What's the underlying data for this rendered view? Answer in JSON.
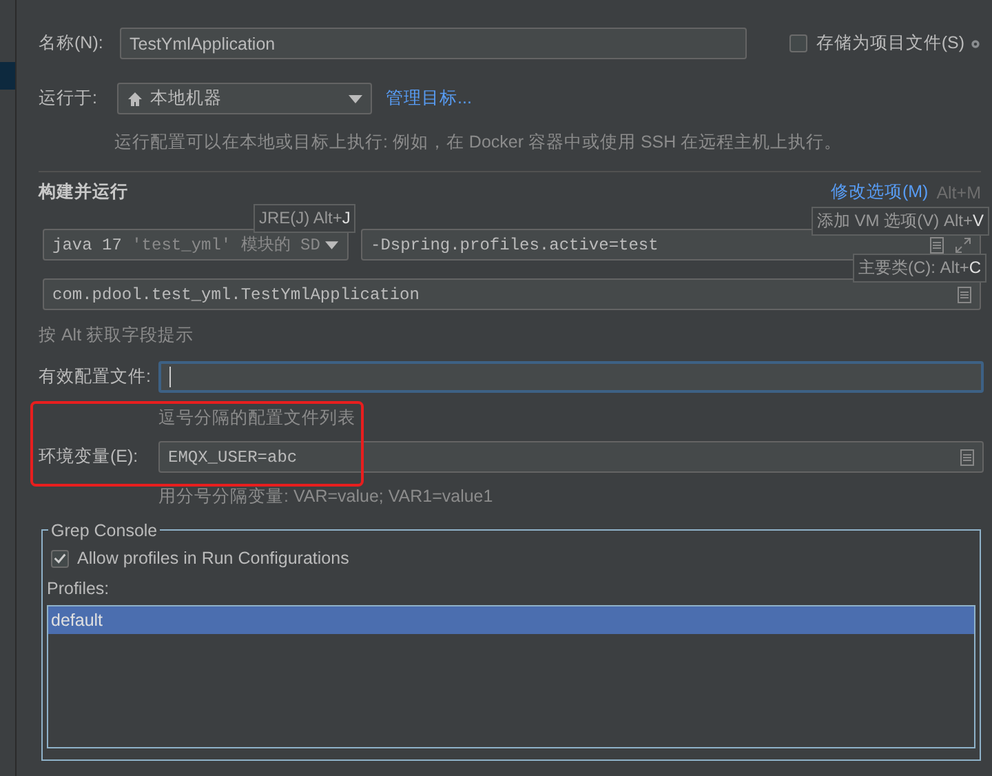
{
  "name": {
    "label": "名称(N):",
    "value": "TestYmlApplication"
  },
  "store_as_project_file": {
    "label": "存储为项目文件(S)",
    "checked": false
  },
  "run_on": {
    "label": "运行于:",
    "value": "本地机器",
    "link": "管理目标...",
    "hint": "运行配置可以在本地或目标上执行: 例如，在 Docker 容器中或使用 SSH 在远程主机上执行。"
  },
  "build_and_run": {
    "title": "构建并运行",
    "modify_options": "修改选项(M)",
    "modify_shortcut": "Alt+M",
    "jre": {
      "prefix": "java 17",
      "module": "'test_yml'",
      "suffix": "模块的 SD"
    },
    "vm_options": "-Dspring.profiles.active=test",
    "main_class": "com.pdool.test_yml.TestYmlApplication",
    "hint": "按 Alt 获取字段提示",
    "tooltips": [
      {
        "kind": "jre",
        "text": "JRE(J) Alt+",
        "key": "J"
      },
      {
        "kind": "vm",
        "text": "添加 VM 选项(V) Alt+",
        "key": "V"
      },
      {
        "kind": "main",
        "text": "主要类(C): Alt+",
        "key": "C"
      }
    ]
  },
  "active_profiles": {
    "label": "有效配置文件:",
    "focused": true,
    "hint": "逗号分隔的配置文件列表"
  },
  "environment": {
    "label": "环境变量(E):",
    "value": "EMQX_USER=abc",
    "hint": "用分号分隔变量: VAR=value; VAR1=value1"
  },
  "grep_console": {
    "title": "Grep Console",
    "allow_profiles": {
      "label": "Allow profiles in Run Configurations",
      "checked": true
    },
    "profiles_label": "Profiles:",
    "profiles": [
      {
        "name": "default",
        "selected": true
      }
    ]
  }
}
